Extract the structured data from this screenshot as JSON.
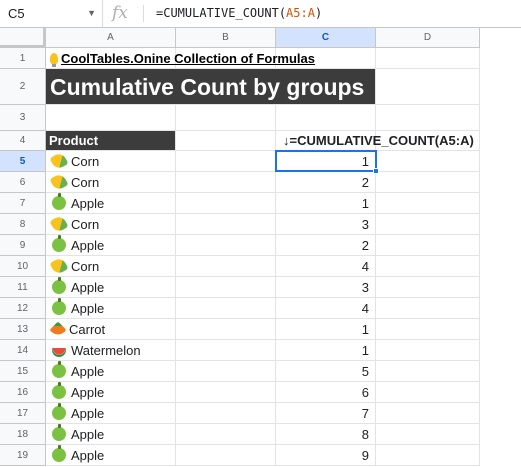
{
  "formula_bar": {
    "cell_ref": "C5",
    "fx_label": "fx",
    "formula_prefix": "=CUMULATIVE_COUNT(",
    "formula_ref": "A5:A",
    "formula_suffix": ")"
  },
  "columns": [
    "A",
    "B",
    "C",
    "D"
  ],
  "rows": [
    "1",
    "2",
    "3",
    "4",
    "5",
    "6",
    "7",
    "8",
    "9",
    "10",
    "11",
    "12",
    "13",
    "14",
    "15",
    "16",
    "17",
    "18",
    "19"
  ],
  "sheet": {
    "title_link": "CoolTables.Onine Collection of Formulas",
    "heading": "Cumulative Count by groups",
    "header_product": "Product",
    "header_formula": "↓=CUMULATIVE_COUNT(A5:A)"
  },
  "data_rows": [
    {
      "product": "Corn",
      "icon": "corn-icon",
      "count": "1"
    },
    {
      "product": "Corn",
      "icon": "corn-icon",
      "count": "2"
    },
    {
      "product": "Apple",
      "icon": "apple-icon",
      "count": "1"
    },
    {
      "product": "Corn",
      "icon": "corn-icon",
      "count": "3"
    },
    {
      "product": "Apple",
      "icon": "apple-icon",
      "count": "2"
    },
    {
      "product": "Corn",
      "icon": "corn-icon",
      "count": "4"
    },
    {
      "product": "Apple",
      "icon": "apple-icon",
      "count": "3"
    },
    {
      "product": "Apple",
      "icon": "apple-icon",
      "count": "4"
    },
    {
      "product": "Carrot",
      "icon": "carrot-icon",
      "count": "1"
    },
    {
      "product": "Watermelon",
      "icon": "watermelon-icon",
      "count": "1"
    },
    {
      "product": "Apple",
      "icon": "apple-icon",
      "count": "5"
    },
    {
      "product": "Apple",
      "icon": "apple-icon",
      "count": "6"
    },
    {
      "product": "Apple",
      "icon": "apple-icon",
      "count": "7"
    },
    {
      "product": "Apple",
      "icon": "apple-icon",
      "count": "8"
    },
    {
      "product": "Apple",
      "icon": "apple-icon",
      "count": "9"
    }
  ],
  "selected_cell": "C5",
  "colors": {
    "header_dark": "#3c3c3c",
    "selection": "#1a73e8",
    "formula_ref": "#d35400"
  }
}
